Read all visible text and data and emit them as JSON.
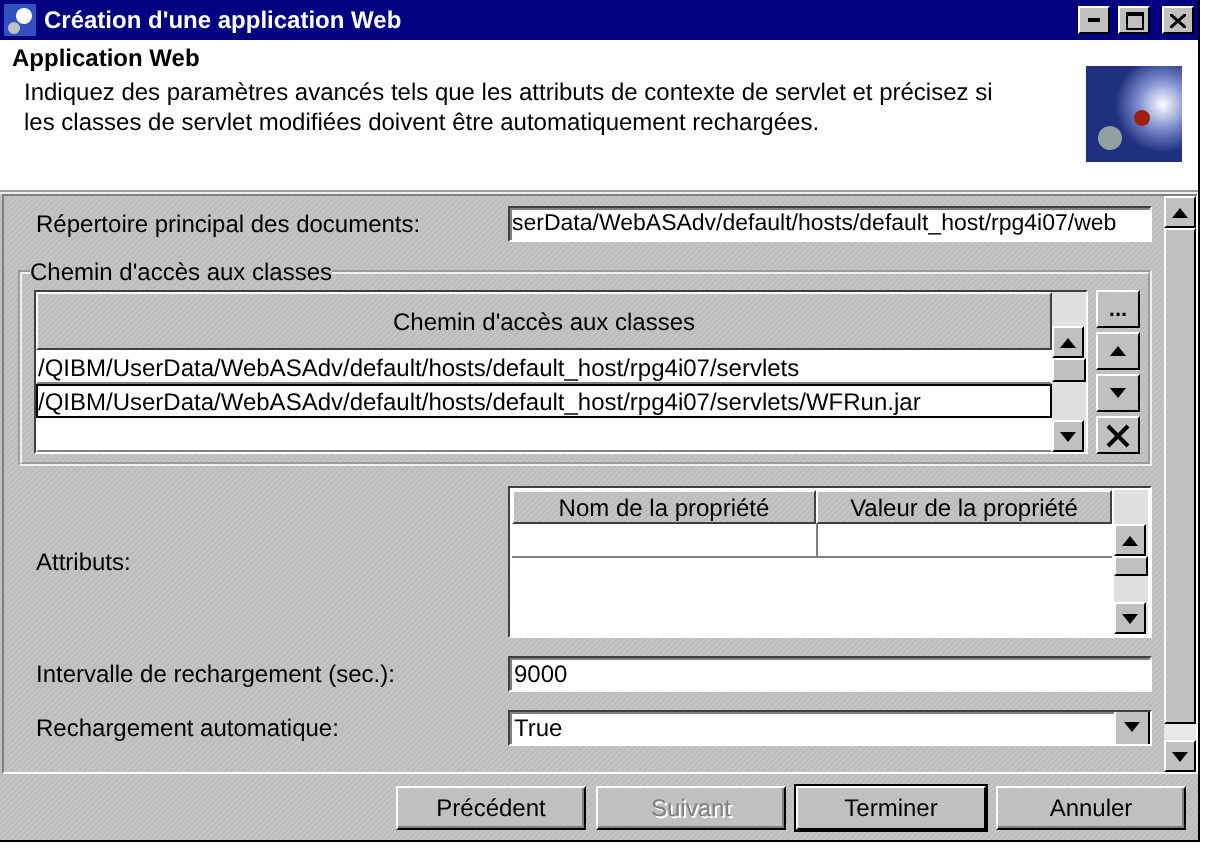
{
  "window": {
    "title": "Création d'une application Web"
  },
  "header": {
    "heading": "Application Web",
    "description": "Indiquez des paramètres avancés tels que les attributs de contexte de servlet et précisez si les classes de servlet modifiées doivent être automatiquement rechargées."
  },
  "document_root": {
    "label": "Répertoire principal des documents:",
    "value": "serData/WebASAdv/default/hosts/default_host/rpg4i07/web"
  },
  "classpath": {
    "group_title": "Chemin d'accès aux classes",
    "column": "Chemin d'accès aux classes",
    "rows": [
      {
        "text": "/QIBM/UserData/WebASAdv/default/hosts/default_host/rpg4i07/servlets",
        "selected": false
      },
      {
        "text": "/QIBM/UserData/WebASAdv/default/hosts/default_host/rpg4i07/servlets/WFRun.jar",
        "selected": true
      }
    ],
    "side_buttons": [
      {
        "kind": "browse",
        "label": "..."
      },
      {
        "kind": "up"
      },
      {
        "kind": "down"
      },
      {
        "kind": "remove"
      }
    ]
  },
  "attributes": {
    "label": "Attributs:",
    "columns": [
      "Nom de la propriété",
      "Valeur de la propriété"
    ]
  },
  "reload_interval": {
    "label": "Intervalle de rechargement (sec.):",
    "value": "9000"
  },
  "auto_reload": {
    "label": "Rechargement automatique:",
    "value": "True"
  },
  "buttons": [
    {
      "label": "Précédent",
      "disabled": false,
      "default": false
    },
    {
      "label": "Suivant",
      "disabled": true,
      "default": false
    },
    {
      "label": "Terminer",
      "disabled": false,
      "default": true
    },
    {
      "label": "Annuler",
      "disabled": false,
      "default": false
    }
  ]
}
